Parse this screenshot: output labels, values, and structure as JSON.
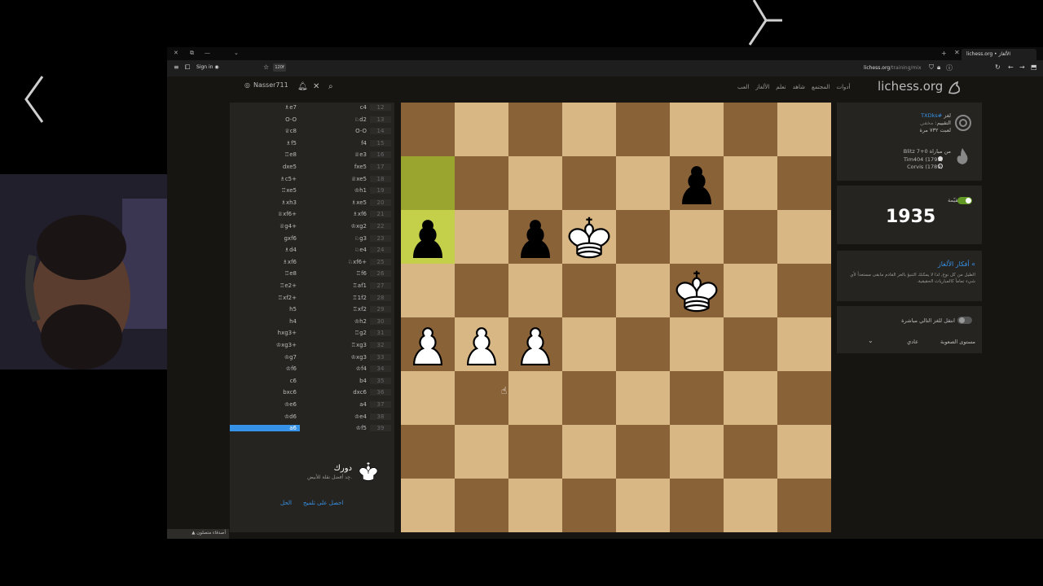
{
  "browser": {
    "tab_title": "lichess.org • الألغاز",
    "signin_label": "Sign in",
    "ext_badge": "120f",
    "url_domain": "lichess.org",
    "url_path": "/training/mix"
  },
  "header": {
    "username": "Nasser711",
    "brand": "lichess.org",
    "nav": [
      "العب",
      "الألغاز",
      "تعلم",
      "شاهد",
      "المجتمع",
      "أدوات"
    ]
  },
  "moves": {
    "rows": [
      {
        "num": "12",
        "white": "c4",
        "black": "♗e7"
      },
      {
        "num": "13",
        "white": "♘d2",
        "black": "O-O"
      },
      {
        "num": "14",
        "white": "O-O",
        "black": "♕c8"
      },
      {
        "num": "15",
        "white": "f4",
        "black": "♗f5"
      },
      {
        "num": "16",
        "white": "♕e3",
        "black": "♖e8"
      },
      {
        "num": "17",
        "white": "fxe5",
        "black": "dxe5"
      },
      {
        "num": "18",
        "white": "♕xe5",
        "black": "♗c5+"
      },
      {
        "num": "19",
        "white": "♔h1",
        "black": "♖xe5"
      },
      {
        "num": "20",
        "white": "♗xe5",
        "black": "♗xh3"
      },
      {
        "num": "21",
        "white": "♗xf6",
        "black": "♕xf6+"
      },
      {
        "num": "22",
        "white": "♔xg2",
        "black": "♕g4+"
      },
      {
        "num": "23",
        "white": "♘g3",
        "black": "gxf6"
      },
      {
        "num": "24",
        "white": "♘e4",
        "black": "♗d4"
      },
      {
        "num": "25",
        "white": "♘xf6+",
        "black": "♗xf6"
      },
      {
        "num": "26",
        "white": "♖f6",
        "black": "♖e8"
      },
      {
        "num": "27",
        "white": "♖af1",
        "black": "♖e2+"
      },
      {
        "num": "28",
        "white": "♖1f2",
        "black": "♖xf2+"
      },
      {
        "num": "29",
        "white": "♖xf2",
        "black": "h5"
      },
      {
        "num": "30",
        "white": "♔h2",
        "black": "h4"
      },
      {
        "num": "31",
        "white": "♖g2",
        "black": "hxg3+"
      },
      {
        "num": "32",
        "white": "♖xg3",
        "black": "♔xg3+"
      },
      {
        "num": "33",
        "white": "♔xg3",
        "black": "♔g7"
      },
      {
        "num": "34",
        "white": "♔f4",
        "black": "♔f6"
      },
      {
        "num": "35",
        "white": "b4",
        "black": "c6"
      },
      {
        "num": "36",
        "white": "dxc6",
        "black": "bxc6"
      },
      {
        "num": "37",
        "white": "a4",
        "black": "♔e6"
      },
      {
        "num": "38",
        "white": "♔e4",
        "black": "♔d6"
      },
      {
        "num": "39",
        "white": "♔f5",
        "black": "a6"
      }
    ]
  },
  "turn": {
    "title": "دورك",
    "subtitle": "جِد أفضل نقلة للأبيض.",
    "hint_label": "احصل على تلميح",
    "solution_label": "الحل"
  },
  "puzzle_info": {
    "puzzle_label": "لغز",
    "puzzle_id": "#TXDks",
    "rating_label": "التقييم:",
    "rating_hidden": "مخفي",
    "plays": "لعبت ٧٣٢ مرة",
    "from_game": "من مباراة 0+7 Blitz",
    "player_white": "Tim404 (1793)",
    "player_black": "Corvis (1789)"
  },
  "rating_panel": {
    "label": "مقيّمة",
    "rating": "1935"
  },
  "ideas": {
    "title": "» أفكار الألغاز",
    "text": "الطيل من كل نوع, لذا لا يمكنك التنبؤ بالعز القادم مابقى مستعداً لأي شيء تماماً كالمباريات الحقيقية."
  },
  "settings": {
    "auto_next_label": "انتقل للغز التالي مباشرة",
    "difficulty_label": "مستوى الصعوبة",
    "difficulty_value": "عادي",
    "chevron": "⌄"
  },
  "friends_label": "أصدقاء متصلون",
  "colors": {
    "light_square": "#d9b784",
    "dark_square": "#8a6238",
    "highlight": "#9aa52f",
    "accent": "#3692e7",
    "toggle_on": "#629924"
  },
  "board": {
    "pieces": [
      {
        "type": "pawn",
        "color": "black",
        "file": 5,
        "rank": 7
      },
      {
        "type": "pawn",
        "color": "black",
        "file": 0,
        "rank": 6
      },
      {
        "type": "pawn",
        "color": "black",
        "file": 2,
        "rank": 6
      },
      {
        "type": "king",
        "color": "white",
        "file": 3,
        "rank": 6
      },
      {
        "type": "king",
        "color": "white",
        "file": 5,
        "rank": 5
      },
      {
        "type": "pawn",
        "color": "white",
        "file": 0,
        "rank": 4
      },
      {
        "type": "pawn",
        "color": "white",
        "file": 1,
        "rank": 4
      },
      {
        "type": "pawn",
        "color": "white",
        "file": 2,
        "rank": 4
      }
    ],
    "highlights": [
      {
        "file": 0,
        "rank": 7,
        "kind": "from"
      },
      {
        "file": 0,
        "rank": 6,
        "kind": "to"
      }
    ]
  }
}
